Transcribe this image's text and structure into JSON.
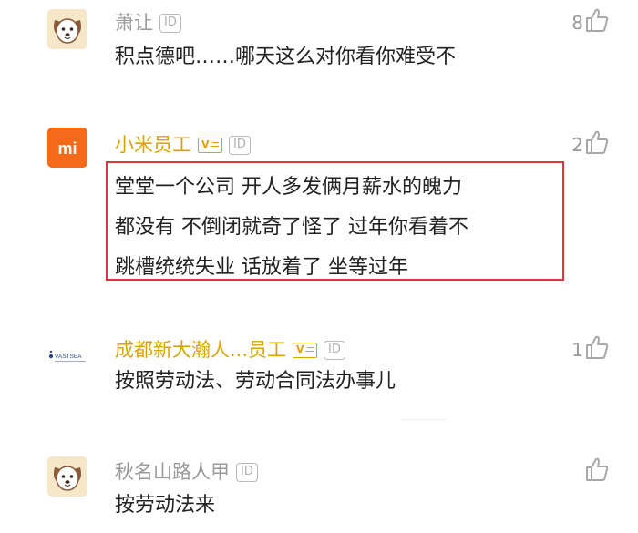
{
  "colors": {
    "username_gray": "#9a9a9a",
    "username_vip": "#d9a400",
    "text": "#222222",
    "highlight_border": "#e2343c",
    "xiaomi_orange": "#f56a19"
  },
  "comments": [
    {
      "avatar_icon": "dog-avatar-icon",
      "username": "萧让",
      "id_badge": "ID",
      "text": [
        "积点德吧……哪天这么对你看你难受不"
      ],
      "likes": "8"
    },
    {
      "avatar_icon": "xiaomi-logo-icon",
      "avatar_text": "mi",
      "username": "小米员工",
      "id_badge": "ID",
      "text": [
        "堂堂一个公司 开人多发俩月薪水的魄力",
        "都没有 不倒闭就奇了怪了 过年你看着不",
        "跳槽统统失业 话放着了 坐等过年"
      ],
      "likes": "2",
      "highlighted": true
    },
    {
      "avatar_icon": "vastsea-logo-icon",
      "avatar_text": "VASTSEA",
      "username": "成都新大瀚人...员工",
      "id_badge": "ID",
      "text": [
        "按照劳动法、劳动合同法办事儿"
      ],
      "likes": "1"
    },
    {
      "avatar_icon": "dog-avatar-icon",
      "username": "秋名山路人甲",
      "id_badge": "ID",
      "text": [
        "按劳动法来"
      ],
      "likes": ""
    }
  ]
}
